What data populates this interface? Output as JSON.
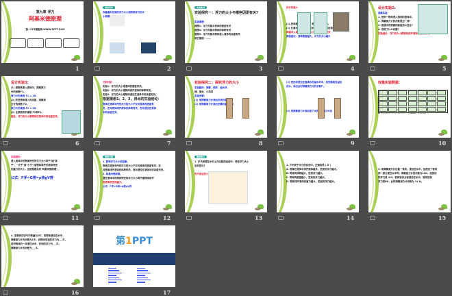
{
  "view": "slide-sorter",
  "slides": [
    {
      "number": "1",
      "layout": "title",
      "lines": [
        {
          "t": "第九章 浮力",
          "c": "center big"
        },
        {
          "t": "阿基米德原理",
          "c": "title"
        },
        {
          "t": "",
          "c": ""
        },
        {
          "t": "第一PPT模板网-WWW.1PPT.COM",
          "c": "center"
        }
      ],
      "boxes": 4
    },
    {
      "number": "2",
      "lines": [
        {
          "t": "课前导学",
          "c": "tag"
        },
        {
          "t": "你看看你见到的浮力大小相同和浮力的大",
          "c": "blue"
        },
        {
          "t": "小和哪些因素有关呢?",
          "c": "blue"
        }
      ],
      "pics": [
        "fish",
        "fish",
        "fish",
        "fish"
      ]
    },
    {
      "number": "3",
      "lines": [
        {
          "t": "实验探究",
          "c": "tag"
        },
        {
          "t": "实验探究一：浮力的大小与哪些因素有关?",
          "c": "big"
        },
        {
          "t": "",
          "c": ""
        },
        {
          "t": "    实验猜想：",
          "c": "blue"
        },
        {
          "t": "猜想1：浮力可能与液体的密度有关",
          "c": ""
        },
        {
          "t": "猜想2：浮力可能与物体的体积有关",
          "c": ""
        },
        {
          "t": "猜想3：浮力可能与物体浸入液体的深度有关",
          "c": ""
        },
        {
          "t": "其它猜想：……",
          "c": ""
        }
      ]
    },
    {
      "number": "4",
      "lines": [
        {
          "t": "设计实验1:",
          "c": "red"
        },
        {
          "t": "",
          "c": ""
        },
        {
          "t": "",
          "c": ""
        },
        {
          "t": "",
          "c": ""
        },
        {
          "t": "(1) 把鸡蛋放入清水中，观察出现的现象。",
          "c": ""
        },
        {
          "t": "(2) 在清水中加盐，改变水的密度，观察出现的现象。",
          "c": ""
        },
        {
          "t": "   鸡蛋浮入清水中，浮力大小与液体密度有关",
          "c": "red"
        },
        {
          "t": "实验结论：液体密度越大，浮力的大小越大",
          "c": "blue"
        }
      ],
      "pics": [
        "beaker",
        "beaker",
        "egg"
      ]
    },
    {
      "number": "5",
      "lines": [
        {
          "t": "设计实验2:",
          "c": "red big"
        },
        {
          "t": "观察实验",
          "c": "blue"
        },
        {
          "t": "1. 把同一物体浸入相同的液体中。",
          "c": ""
        },
        {
          "t": "2. 弹簧测力计的示数是否一样?",
          "c": ""
        },
        {
          "t": "3. 容器中的液面的高度怎么变化?",
          "c": ""
        },
        {
          "t": "4. 说明了什么问题?",
          "c": ""
        },
        {
          "t": "实验结论：浮力的大小跟物体排开液体的体积有关。",
          "c": "red"
        }
      ],
      "pics": [
        "tank"
      ]
    },
    {
      "number": "6",
      "lines": [
        {
          "t": "设计实验3:",
          "c": "red big"
        },
        {
          "t": "(1) 把物体浸入液体中，观察弹力",
          "c": ""
        },
        {
          "t": "计的读数F1。",
          "c": ""
        },
        {
          "t": "   弹力计的读数 F1 = 2N",
          "c": "blue"
        },
        {
          "t": "(2) 改变物体浸入的深度，观察弹",
          "c": ""
        },
        {
          "t": "力计的读数 F2。",
          "c": ""
        },
        {
          "t": "   弹力计的读数 F2 = 2N",
          "c": "blue"
        },
        {
          "t": "(3) 比较两次的读数 F1和F2。",
          "c": ""
        },
        {
          "t": "结论：浮力的大小跟物体在液体中的深度无关。",
          "c": "red"
        }
      ],
      "pics": [
        "spring-tank"
      ]
    },
    {
      "number": "7",
      "lines": [
        {
          "t": "分析归纳",
          "c": "pink"
        },
        {
          "t": "实验1：浮力的大小跟液体的密度有关。",
          "c": ""
        },
        {
          "t": "实验2：浮力的大小跟物体排开液体的体积有关。",
          "c": ""
        },
        {
          "t": "实验3：浮力的大小跟物体浸没在液体中的深度无关。",
          "c": ""
        },
        {
          "t": "根据猜想1、2、3，得出的实验结论：",
          "c": "big"
        },
        {
          "t": "物体在液体中所受浮力的大小不仅与液体的密度有",
          "c": "blue"
        },
        {
          "t": "关，还与物体排开液体的体积有关，而与浸没在液体",
          "c": "blue"
        },
        {
          "t": "中的深度无关。",
          "c": "blue"
        }
      ]
    },
    {
      "number": "8",
      "lines": [
        {
          "t": "实验探究二：探究浮力的大小",
          "c": "red big"
        },
        {
          "t": "实验器材：弹簧、烧杯、溢水杯、",
          "c": "blue"
        },
        {
          "t": "桶、清水、小石块",
          "c": ""
        },
        {
          "t": "实验步骤：",
          "c": "blue"
        },
        {
          "t": "(1) 用弹簧测力计测出石块的重力G",
          "c": "blue"
        },
        {
          "t": "(2) 用弹簧测力计测出空桶的重力G桶",
          "c": "blue"
        }
      ],
      "pics": [
        "spring",
        "spring"
      ]
    },
    {
      "number": "9",
      "lines": [
        {
          "t": "(3) 把石块浸没在盛满水的溢水杯中，用空桶接住溢出",
          "c": "blue"
        },
        {
          "t": "的水，读出此时弹簧测力计的示数F'。",
          "c": "blue"
        },
        {
          "t": "",
          "c": ""
        },
        {
          "t": "",
          "c": ""
        },
        {
          "t": "",
          "c": ""
        },
        {
          "t": "",
          "c": ""
        },
        {
          "t": "",
          "c": ""
        },
        {
          "t": "(4) 用弹簧测力计测出接了水的桶的重力G总",
          "c": "blue"
        }
      ],
      "pics": [
        "spring",
        "spring"
      ]
    },
    {
      "number": "10",
      "lines": [
        {
          "t": "收集实验数据：",
          "c": "red big"
        },
        {
          "t": "",
          "c": ""
        },
        {
          "t": "",
          "c": ""
        },
        {
          "t": "",
          "c": ""
        },
        {
          "t": "",
          "c": ""
        },
        {
          "t": "",
          "c": ""
        },
        {
          "t": "",
          "c": ""
        },
        {
          "t": "比较浮力的大小和物体排开水的重量，你发现了什么?",
          "c": ""
        }
      ],
      "table": true
    },
    {
      "number": "11",
      "lines": [
        {
          "t": "实验结论:",
          "c": "pink"
        },
        {
          "t": "浸入液体中的物体所受的浮力大小等于(填\"等",
          "c": ""
        },
        {
          "t": "于\"、\"大于\"或\"小于\")被物体排开的液体所受",
          "c": ""
        },
        {
          "t": "的重力的大小。这便是著名的\"阿基米德原理\"。",
          "c": ""
        },
        {
          "t": "",
          "c": ""
        },
        {
          "t": "   公式：F浮=G排=ρ液gV排",
          "c": "blue big"
        }
      ]
    },
    {
      "number": "12",
      "lines": [
        {
          "t": "课堂小结",
          "c": "tag"
        },
        {
          "t": "1. 影响浮力大小的因素。",
          "c": "blue"
        },
        {
          "t": "   物体在液体中所受浮力的大小不仅与液体的密度有关，还",
          "c": ""
        },
        {
          "t": "与物体排开液体的体积有关，而与浸没在液体中的深度无关。",
          "c": ""
        },
        {
          "t": "2. 阿基米德原理。",
          "c": "blue"
        },
        {
          "t": "   浸在液体中的物体所受的浮力大小等于被物体排开",
          "c": ""
        },
        {
          "t": "的液体所受的重力。",
          "c": "red"
        },
        {
          "t": "公式：F浮=G排=ρ液gV排",
          "c": "blue"
        }
      ]
    },
    {
      "number": "13",
      "lines": [
        {
          "t": "随堂练习",
          "c": "tag"
        },
        {
          "t": "1. 乒乓球浸在水中上浮过程的运动中，所受浮力大小",
          "c": ""
        },
        {
          "t": "如何变化?",
          "c": ""
        },
        {
          "t": "",
          "c": ""
        },
        {
          "t": "                                先不变后变小",
          "c": "red"
        }
      ],
      "pics": [
        "water"
      ]
    },
    {
      "number": "14",
      "lines": [
        {
          "t": "",
          "c": ""
        },
        {
          "t": "",
          "c": ""
        },
        {
          "t": "2. 下列关于浮力的说法中，正确的是 ( D )",
          "c": ""
        },
        {
          "t": "A. 物体在液体中排开液体越多，受到的浮力越大。",
          "c": ""
        },
        {
          "t": "B. 物体的体积越大，受到浮力越大。",
          "c": ""
        },
        {
          "t": "C. 物体的密度越小，受到的浮力越大。",
          "c": ""
        },
        {
          "t": "D. 物体排开液体的重力越大，受到的浮力越大。",
          "c": ""
        }
      ]
    },
    {
      "number": "15",
      "lines": [
        {
          "t": "",
          "c": ""
        },
        {
          "t": "",
          "c": ""
        },
        {
          "t": "",
          "c": ""
        },
        {
          "t": "3. 用弹簧测力计拉着一铁块，浸没在水中，当把这个铁块",
          "c": ""
        },
        {
          "t": "的一部分浸在水中时，弹簧测力计的示数为10N，则铁块",
          "c": ""
        },
        {
          "t": "的浮力是 4 N，若将铁块全部浸没在水中，铁块受到",
          "c": ""
        },
        {
          "t": "浮力是8N，此时弹簧测力计示数为 14 N。",
          "c": ""
        }
      ]
    },
    {
      "number": "16",
      "lines": [
        {
          "t": "",
          "c": ""
        },
        {
          "t": "4. 某物体在空气中称重为2牛，将物体浸没在水中，",
          "c": ""
        },
        {
          "t": "弹簧测力计的示数为1牛，则物体受到的浮力为___牛，",
          "c": ""
        },
        {
          "t": "若把物体的一半浸在水中，受到的浮力为___牛，",
          "c": ""
        },
        {
          "t": "弹簧测力计的示数为___牛。",
          "c": ""
        }
      ]
    },
    {
      "number": "17",
      "layout": "brand",
      "brand": {
        "prefix": "第",
        "digit": "1",
        "suffix": "PPT"
      },
      "lines": []
    }
  ]
}
